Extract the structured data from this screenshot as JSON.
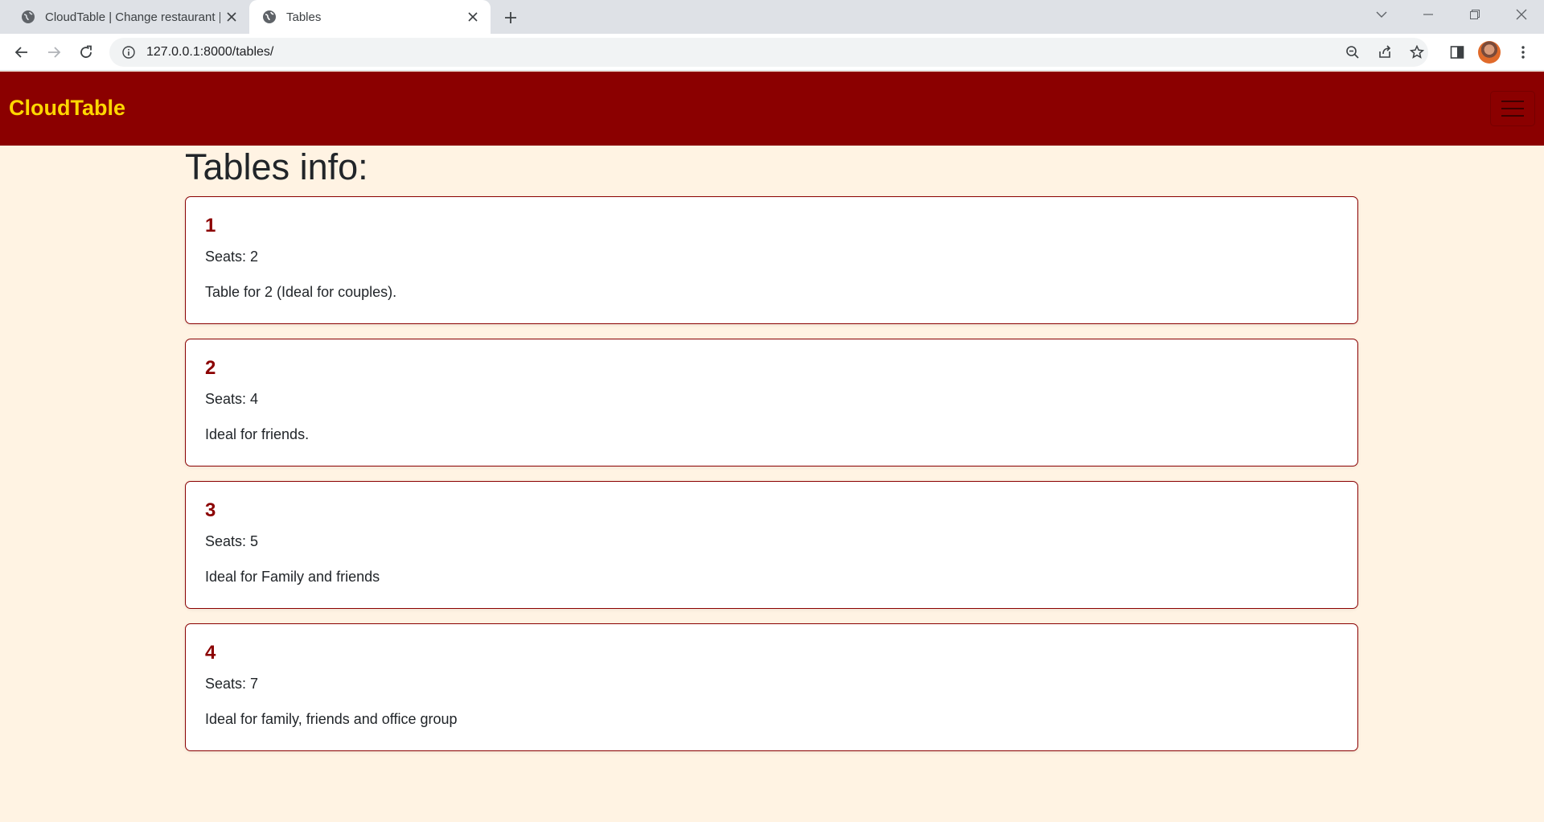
{
  "browser": {
    "tabs": [
      {
        "title": "CloudTable | Change restaurant |",
        "icon": "globe-icon",
        "active": false
      },
      {
        "title": "Tables",
        "icon": "globe-icon",
        "active": true
      }
    ],
    "url": "127.0.0.1:8000/tables/"
  },
  "site": {
    "brand": "CloudTable",
    "colors": {
      "navbar": "#8b0000",
      "brand": "#ffd700",
      "background": "#fff3e3",
      "card_border": "#8b0000"
    }
  },
  "main": {
    "heading": "Tables info:",
    "tables": [
      {
        "number": "1",
        "seats": "Seats: 2",
        "description": "Table for 2 (Ideal for couples)."
      },
      {
        "number": "2",
        "seats": "Seats: 4",
        "description": "Ideal for friends."
      },
      {
        "number": "3",
        "seats": "Seats: 5",
        "description": "Ideal for Family and friends"
      },
      {
        "number": "4",
        "seats": "Seats: 7",
        "description": "Ideal for family, friends and office group"
      }
    ]
  }
}
